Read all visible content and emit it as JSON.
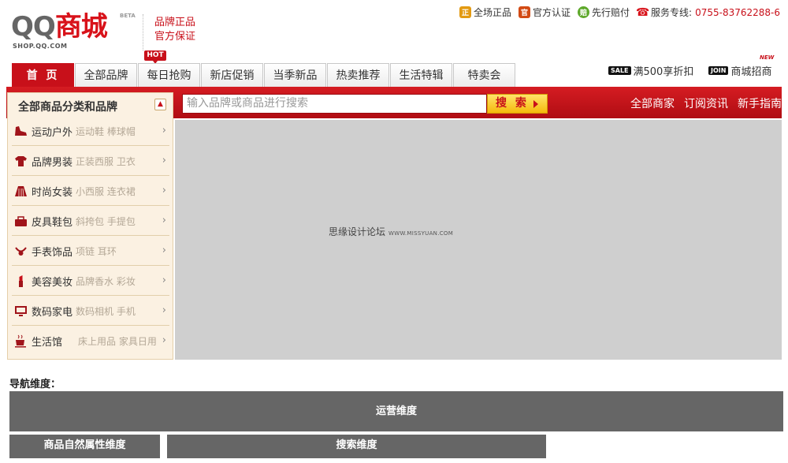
{
  "logo": {
    "qq": "QQ",
    "mall": "商城",
    "beta": "BETA",
    "url": "SHOP.QQ.COM"
  },
  "slogan": {
    "line1": "品牌正品",
    "line2": "官方保证"
  },
  "top_links": [
    {
      "label": "全场正品",
      "icon": "genuine-icon",
      "color": "#e39a12"
    },
    {
      "label": "官方认证",
      "icon": "certified-icon",
      "color": "#d24a14"
    },
    {
      "label": "先行赔付",
      "icon": "compensate-icon",
      "color": "#5da82a"
    },
    {
      "label": "服务专线:",
      "icon": "phone-icon",
      "color": "#d8121a"
    }
  ],
  "phone": "0755-83762288-6",
  "nav_tabs": [
    "首 页",
    "全部品牌",
    "每日抢购",
    "新店促销",
    "当季新品",
    "热卖推荐",
    "生活特辑",
    "特卖会"
  ],
  "hot_badge": "HOT",
  "promos": [
    {
      "tag": "SALE",
      "label": "满500享折扣"
    },
    {
      "tag": "JOIN",
      "label": "商城招商"
    }
  ],
  "new_badge": "NEW",
  "category_header": "全部商品分类和品牌",
  "search": {
    "placeholder": "输入品牌或商品进行搜索",
    "button": "搜 索"
  },
  "bar_links": [
    "全部商家",
    "订阅资讯",
    "新手指南"
  ],
  "categories": [
    {
      "name": "运动户外",
      "sub": "运动鞋 棒球帽",
      "icon": "shoe-icon"
    },
    {
      "name": "品牌男装",
      "sub": "正装西服 卫衣",
      "icon": "shirt-icon"
    },
    {
      "name": "时尚女装",
      "sub": "小西服 连衣裙",
      "icon": "skirt-icon"
    },
    {
      "name": "皮具鞋包",
      "sub": "斜挎包 手提包",
      "icon": "bag-icon"
    },
    {
      "name": "手表饰品",
      "sub": "项链 耳环",
      "icon": "jewelry-icon"
    },
    {
      "name": "美容美妆",
      "sub": "品牌香水 彩妆",
      "icon": "lipstick-icon"
    },
    {
      "name": "数码家电",
      "sub": "数码相机 手机",
      "icon": "monitor-icon"
    },
    {
      "name": "生活馆",
      "sub": "床上用品 家具日用",
      "icon": "cup-icon"
    }
  ],
  "banner": {
    "text": "思缘设计论坛",
    "url": "WWW.MISSYUAN.COM"
  },
  "nav_dimension_label": "导航维度：",
  "dimensions": {
    "operation": "运营维度",
    "attribute": "商品自然属性维度",
    "search": "搜索维度"
  },
  "colors": {
    "brand_red": "#c8101a",
    "panel": "#fbf1e2",
    "gray_block": "#666666"
  }
}
